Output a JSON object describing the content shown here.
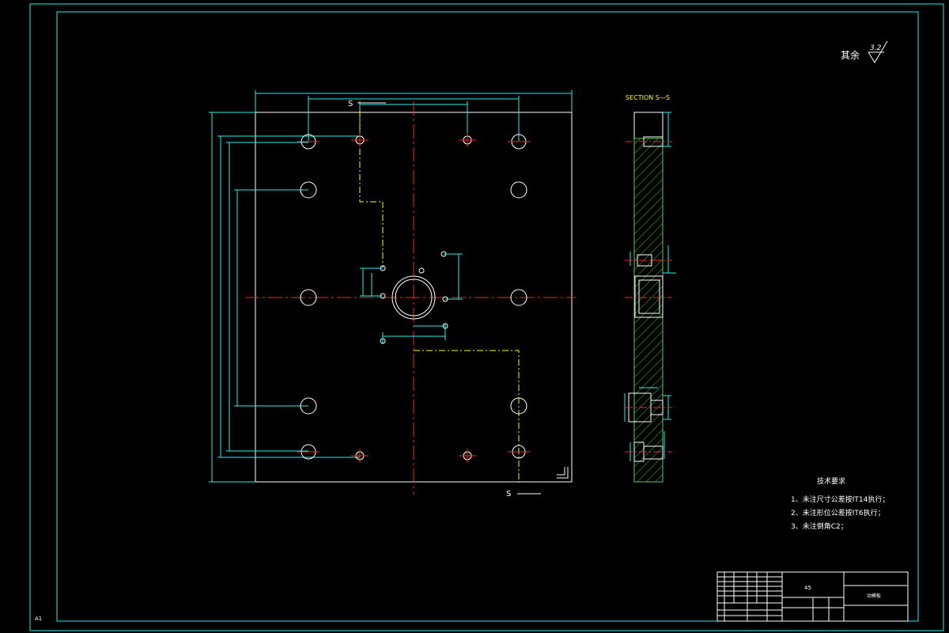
{
  "surface_finish": {
    "label": "其余",
    "value": "3.2"
  },
  "section_title": "SECTION S—S",
  "section_marks": {
    "top": "S",
    "bottom": "S"
  },
  "sheet_corner_label": "A1",
  "tech_requirements": {
    "title": "技术要求",
    "items": [
      "1、未注尺寸公差按IT14执行；",
      "2、未注形位公差按IT6执行；",
      "3、未注倒角C2；"
    ]
  },
  "title_block": {
    "material": "45",
    "part_name": "动模板"
  },
  "colors": {
    "background": "#000000",
    "frame": "#2ee6e6",
    "outline": "#ffffff",
    "centerline": "#ff2222",
    "hidden": "#ffff00",
    "hatch": "#55cc55"
  }
}
